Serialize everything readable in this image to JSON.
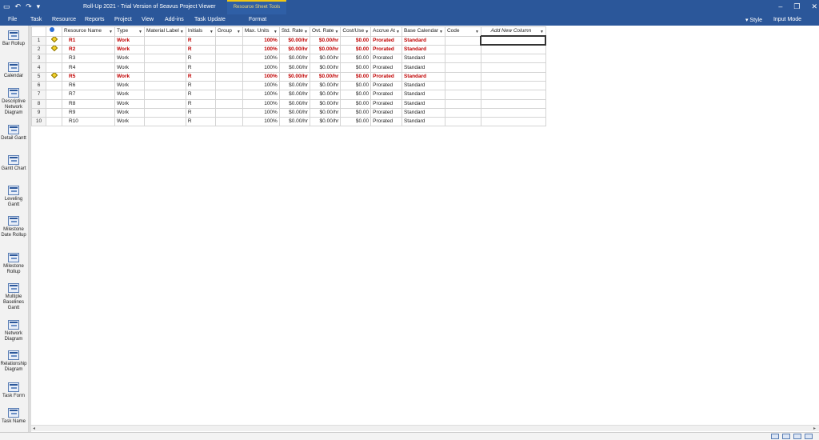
{
  "window": {
    "title": "Roll-Up 2021 - Trial Version of Seavus Project Viewer",
    "contextual_group": "Resource Sheet Tools"
  },
  "ribbon": {
    "tabs": [
      "File",
      "Task",
      "Resource",
      "Reports",
      "Project",
      "View",
      "Add-ins",
      "Task Update",
      "Format"
    ],
    "style_label": "Style",
    "input_mode_label": "Input Mode"
  },
  "views": [
    {
      "label": "Bar Rollup",
      "icon": "bar-rollup-icon"
    },
    {
      "label": "Calendar",
      "icon": "calendar-icon"
    },
    {
      "label": "Descriptive Network Diagram",
      "icon": "network-diagram-icon"
    },
    {
      "label": "Detail Gantt",
      "icon": "gantt-icon"
    },
    {
      "label": "Gantt Chart",
      "icon": "gantt-icon"
    },
    {
      "label": "Leveling Gantt",
      "icon": "gantt-icon"
    },
    {
      "label": "Milestone Date Rollup",
      "icon": "gantt-icon"
    },
    {
      "label": "Milestone Rollup",
      "icon": "gantt-icon"
    },
    {
      "label": "Multiple Baselines Gantt",
      "icon": "gantt-icon"
    },
    {
      "label": "Network Diagram",
      "icon": "network-diagram-icon"
    },
    {
      "label": "Relationship Diagram",
      "icon": "relationship-icon"
    },
    {
      "label": "Task Form",
      "icon": "form-icon"
    },
    {
      "label": "Task Name",
      "icon": "form-icon"
    }
  ],
  "sheet": {
    "columns": [
      "Resource Name",
      "Type",
      "Material Label",
      "Initials",
      "Group",
      "Max. Units",
      "Std. Rate",
      "Ovt. Rate",
      "Cost/Use",
      "Accrue At",
      "Base Calendar",
      "Code",
      "Add New Column"
    ],
    "rows": [
      {
        "id": "1",
        "indicator": true,
        "name": "R1",
        "type": "Work",
        "material": "",
        "initials": "R",
        "group": "",
        "max_units": "100%",
        "std_rate": "$0.00/hr",
        "ovt_rate": "$0.00/hr",
        "cost_use": "$0.00",
        "accrue": "Prorated",
        "base_cal": "Standard",
        "code": ""
      },
      {
        "id": "2",
        "indicator": true,
        "name": "R2",
        "type": "Work",
        "material": "",
        "initials": "R",
        "group": "",
        "max_units": "100%",
        "std_rate": "$0.00/hr",
        "ovt_rate": "$0.00/hr",
        "cost_use": "$0.00",
        "accrue": "Prorated",
        "base_cal": "Standard",
        "code": ""
      },
      {
        "id": "3",
        "indicator": false,
        "name": "R3",
        "type": "Work",
        "material": "",
        "initials": "R",
        "group": "",
        "max_units": "100%",
        "std_rate": "$0.00/hr",
        "ovt_rate": "$0.00/hr",
        "cost_use": "$0.00",
        "accrue": "Prorated",
        "base_cal": "Standard",
        "code": ""
      },
      {
        "id": "4",
        "indicator": false,
        "name": "R4",
        "type": "Work",
        "material": "",
        "initials": "R",
        "group": "",
        "max_units": "100%",
        "std_rate": "$0.00/hr",
        "ovt_rate": "$0.00/hr",
        "cost_use": "$0.00",
        "accrue": "Prorated",
        "base_cal": "Standard",
        "code": ""
      },
      {
        "id": "5",
        "indicator": true,
        "name": "R5",
        "type": "Work",
        "material": "",
        "initials": "R",
        "group": "",
        "max_units": "100%",
        "std_rate": "$0.00/hr",
        "ovt_rate": "$0.00/hr",
        "cost_use": "$0.00",
        "accrue": "Prorated",
        "base_cal": "Standard",
        "code": ""
      },
      {
        "id": "6",
        "indicator": false,
        "name": "R6",
        "type": "Work",
        "material": "",
        "initials": "R",
        "group": "",
        "max_units": "100%",
        "std_rate": "$0.00/hr",
        "ovt_rate": "$0.00/hr",
        "cost_use": "$0.00",
        "accrue": "Prorated",
        "base_cal": "Standard",
        "code": ""
      },
      {
        "id": "7",
        "indicator": false,
        "name": "R7",
        "type": "Work",
        "material": "",
        "initials": "R",
        "group": "",
        "max_units": "100%",
        "std_rate": "$0.00/hr",
        "ovt_rate": "$0.00/hr",
        "cost_use": "$0.00",
        "accrue": "Prorated",
        "base_cal": "Standard",
        "code": ""
      },
      {
        "id": "8",
        "indicator": false,
        "name": "R8",
        "type": "Work",
        "material": "",
        "initials": "R",
        "group": "",
        "max_units": "100%",
        "std_rate": "$0.00/hr",
        "ovt_rate": "$0.00/hr",
        "cost_use": "$0.00",
        "accrue": "Prorated",
        "base_cal": "Standard",
        "code": ""
      },
      {
        "id": "9",
        "indicator": false,
        "name": "R9",
        "type": "Work",
        "material": "",
        "initials": "R",
        "group": "",
        "max_units": "100%",
        "std_rate": "$0.00/hr",
        "ovt_rate": "$0.00/hr",
        "cost_use": "$0.00",
        "accrue": "Prorated",
        "base_cal": "Standard",
        "code": ""
      },
      {
        "id": "10",
        "indicator": false,
        "name": "R10",
        "type": "Work",
        "material": "",
        "initials": "R",
        "group": "",
        "max_units": "100%",
        "std_rate": "$0.00/hr",
        "ovt_rate": "$0.00/hr",
        "cost_use": "$0.00",
        "accrue": "Prorated",
        "base_cal": "Standard",
        "code": ""
      }
    ]
  },
  "colors": {
    "brand": "#2b579a",
    "overallocated": "#c00000",
    "contextual_accent": "#f2c811"
  }
}
